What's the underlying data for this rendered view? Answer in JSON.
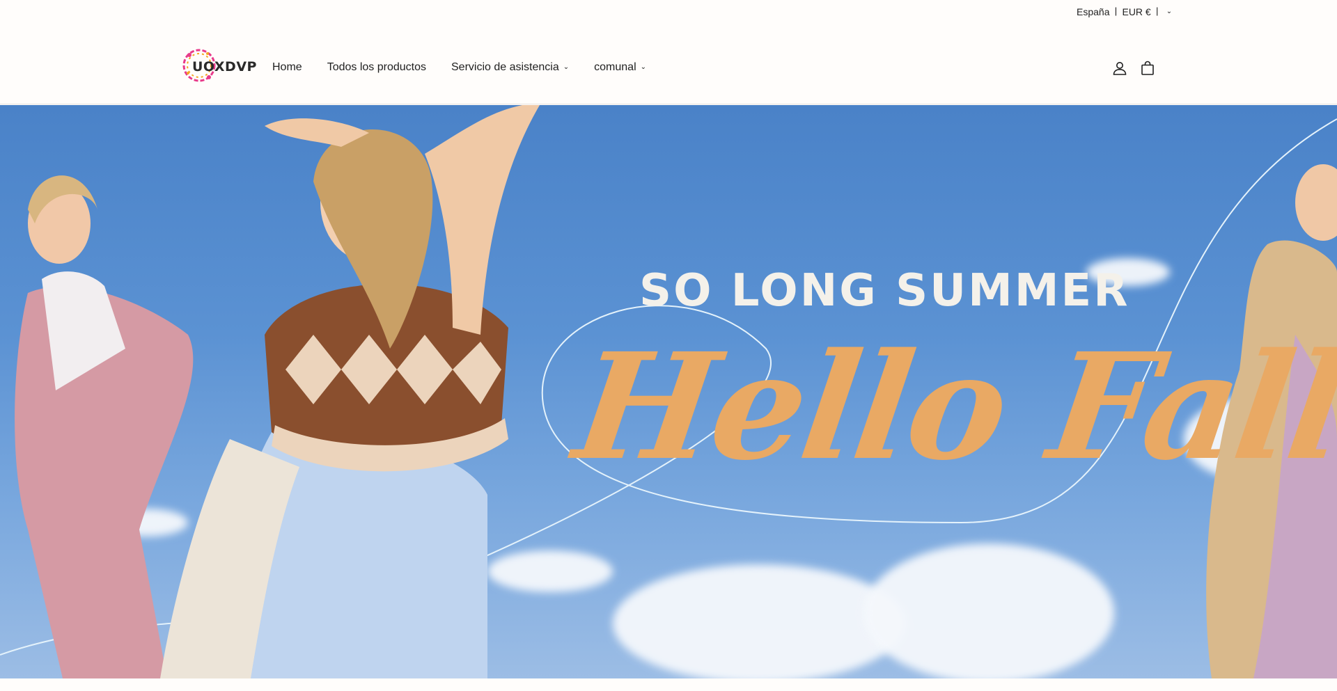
{
  "topbar": {
    "locale_label": "España",
    "separator": "〡",
    "currency_label": "EUR €",
    "separator_end": "〡"
  },
  "header": {
    "logo_text": "UOXDVP",
    "nav": {
      "home": "Home",
      "all_products": "Todos los productos",
      "support": "Servicio de asistencia",
      "community": "comunal"
    }
  },
  "icons": {
    "account": "user-icon",
    "cart": "bag-icon",
    "dropdown": "chevron-down-icon"
  },
  "hero": {
    "subtitle": "SO LONG SUMMER",
    "title": "Hello Fall!"
  },
  "colors": {
    "sky": "#5b92d3",
    "title_accent": "#e9a964",
    "background": "#fffdfb"
  }
}
